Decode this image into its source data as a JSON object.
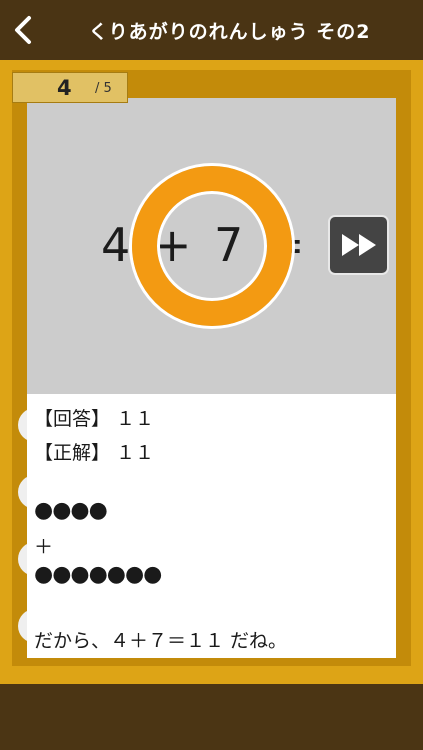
{
  "header": {
    "title": "くりあがりのれんしゅう その2",
    "back_icon": "chevron-left-icon"
  },
  "counter": {
    "current": "4",
    "total": "/ 5"
  },
  "question": {
    "equation": "4 + 7 = ?",
    "result_mark": "correct-circle",
    "skip_icon": "fast-forward-icon"
  },
  "answer": {
    "answer_line": "【回答】 １１",
    "correct_line": "【正解】 １１",
    "dots_a": "●●●●",
    "plus": "＋",
    "dots_b": "●●●●●●●",
    "explanation": "だから、４＋７＝１１ だね。"
  },
  "colors": {
    "header_bg": "#4a3414",
    "board_bg": "#dda416",
    "ring": "#f39a12",
    "panel_gray": "#cccccc"
  }
}
